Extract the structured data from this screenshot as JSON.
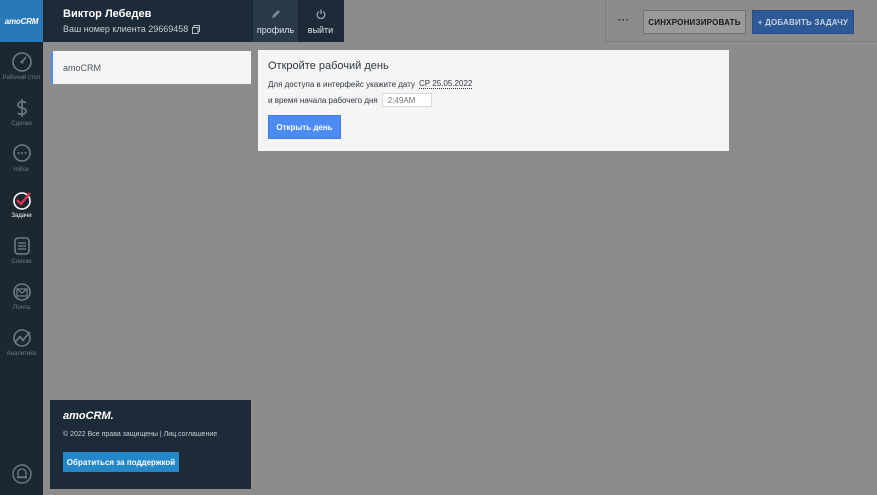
{
  "nav": {
    "logo": "amoCRM",
    "items": [
      {
        "label": "Рабочий стол",
        "icon": "dashboard-icon"
      },
      {
        "label": "Сделки",
        "icon": "dollar-icon"
      },
      {
        "label": "InBox",
        "icon": "chat-icon"
      },
      {
        "label": "Задачи",
        "icon": "check-icon"
      },
      {
        "label": "Списки",
        "icon": "list-icon"
      },
      {
        "label": "Почта",
        "icon": "mail-icon"
      },
      {
        "label": "Аналитика",
        "icon": "analytics-icon"
      }
    ],
    "bottom_icon": "notification-bell-icon"
  },
  "userbar": {
    "name": "Виктор Лебедев",
    "client_id": "Ваш номер клиента 29669458",
    "profile_label": "профиль",
    "logout_label": "выйти"
  },
  "toolbar": {
    "more_label": "···",
    "sync_label": "СИНХРОНИЗИРОВАТЬ",
    "add_task_label": "+ ДОБАВИТЬ ЗАДАЧУ"
  },
  "accounts": [
    {
      "label": "amoCRM"
    }
  ],
  "footer": {
    "logo": "amoCRM.",
    "copyright": "© 2022 Все права защищены | Лиц.соглашение",
    "support_button": "Обратиться за поддержкой"
  },
  "modal": {
    "title": "Откройте рабочий день",
    "line1": "Для доступа в интерфейс укажите дату",
    "date": "СР 25.05.2022",
    "line2": "и время начала рабочего дня",
    "time_placeholder": "2:49AM",
    "open_button": "Открыть день"
  },
  "colors": {
    "nav_bg": "#1d2730",
    "accent_blue": "#4c8bf5",
    "support_blue": "#2487c7",
    "overlay": "#8c8c8c"
  }
}
